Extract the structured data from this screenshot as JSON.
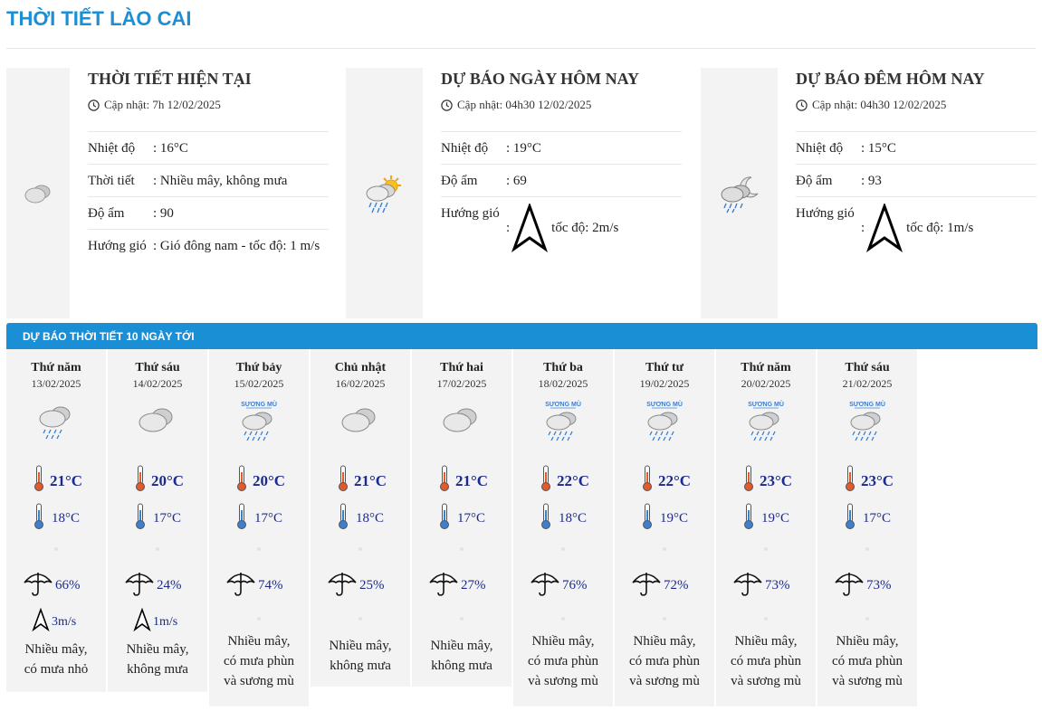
{
  "page": {
    "title": "THỜI TIẾT LÀO CAI"
  },
  "current": {
    "title": "THỜI TIẾT HIỆN TẠI",
    "updated": "Cập nhật: 7h 12/02/2025",
    "icon": "cloudy-icon",
    "rows": [
      {
        "label": "Nhiệt độ",
        "value": ": 16°C"
      },
      {
        "label": "Thời tiết",
        "value": ": Nhiều mây, không mưa"
      },
      {
        "label": "Độ ẩm",
        "value": ": 90"
      },
      {
        "label": "Hướng gió",
        "value": ": Gió đông nam - tốc độ: 1 m/s"
      }
    ]
  },
  "today": {
    "title": "DỰ BÁO NGÀY HÔM NAY",
    "updated": "Cập nhật: 04h30 12/02/2025",
    "icon": "sun-cloud-rain-icon",
    "rows": [
      {
        "label": "Nhiệt độ",
        "value": ": 19°C"
      },
      {
        "label": "Độ ẩm",
        "value": ": 69"
      }
    ],
    "wind": {
      "label": "Hướng gió",
      "prefix": ":",
      "value": "tốc độ: 2m/s"
    }
  },
  "tonight": {
    "title": "DỰ BÁO ĐÊM HÔM NAY",
    "updated": "Cập nhật: 04h30 12/02/2025",
    "icon": "moon-cloud-rain-icon",
    "rows": [
      {
        "label": "Nhiệt độ",
        "value": ": 15°C"
      },
      {
        "label": "Độ ẩm",
        "value": ": 93"
      }
    ],
    "wind": {
      "label": "Hướng gió",
      "prefix": ":",
      "value": "tốc độ: 1m/s"
    }
  },
  "forecast": {
    "header": "DỰ BÁO THỜI TIẾT 10 NGÀY TỚI",
    "fog_label": "SƯƠNG MÙ",
    "days": [
      {
        "name": "Thứ năm",
        "date": "13/02/2025",
        "icon": "cloud-rain-icon",
        "tmax": "21°C",
        "tmin": "18°C",
        "rain": "66%",
        "wind": "3m/s",
        "desc": [
          "Nhiều mây,",
          "có mưa nhỏ"
        ]
      },
      {
        "name": "Thứ sáu",
        "date": "14/02/2025",
        "icon": "cloudy-icon",
        "tmax": "20°C",
        "tmin": "17°C",
        "rain": "24%",
        "wind": "1m/s",
        "desc": [
          "Nhiều mây,",
          "không mưa"
        ]
      },
      {
        "name": "Thứ bảy",
        "date": "15/02/2025",
        "icon": "fog-rain-icon",
        "tmax": "20°C",
        "tmin": "17°C",
        "rain": "74%",
        "wind": "",
        "desc": [
          "Nhiều mây,",
          "có mưa phùn",
          "và sương mù"
        ]
      },
      {
        "name": "Chủ nhật",
        "date": "16/02/2025",
        "icon": "cloudy-icon",
        "tmax": "21°C",
        "tmin": "18°C",
        "rain": "25%",
        "wind": "",
        "desc": [
          "Nhiều mây,",
          "không mưa"
        ]
      },
      {
        "name": "Thứ hai",
        "date": "17/02/2025",
        "icon": "cloudy-icon",
        "tmax": "21°C",
        "tmin": "17°C",
        "rain": "27%",
        "wind": "",
        "desc": [
          "Nhiều mây,",
          "không mưa"
        ]
      },
      {
        "name": "Thứ ba",
        "date": "18/02/2025",
        "icon": "fog-rain-icon",
        "tmax": "22°C",
        "tmin": "18°C",
        "rain": "76%",
        "wind": "",
        "desc": [
          "Nhiều mây,",
          "có mưa phùn",
          "và sương mù"
        ]
      },
      {
        "name": "Thứ tư",
        "date": "19/02/2025",
        "icon": "fog-rain-icon",
        "tmax": "22°C",
        "tmin": "19°C",
        "rain": "72%",
        "wind": "",
        "desc": [
          "Nhiều mây,",
          "có mưa phùn",
          "và sương mù"
        ]
      },
      {
        "name": "Thứ năm",
        "date": "20/02/2025",
        "icon": "fog-rain-icon",
        "tmax": "23°C",
        "tmin": "19°C",
        "rain": "73%",
        "wind": "",
        "desc": [
          "Nhiều mây,",
          "có mưa phùn",
          "và sương mù"
        ]
      },
      {
        "name": "Thứ sáu",
        "date": "21/02/2025",
        "icon": "fog-rain-icon",
        "tmax": "23°C",
        "tmin": "17°C",
        "rain": "73%",
        "wind": "",
        "desc": [
          "Nhiều mây,",
          "có mưa phùn",
          "và sương mù"
        ]
      }
    ]
  },
  "colors": {
    "accent": "#1a8fd6",
    "value_text": "#1c2b8a",
    "panel_bg": "#f3f3f3"
  }
}
